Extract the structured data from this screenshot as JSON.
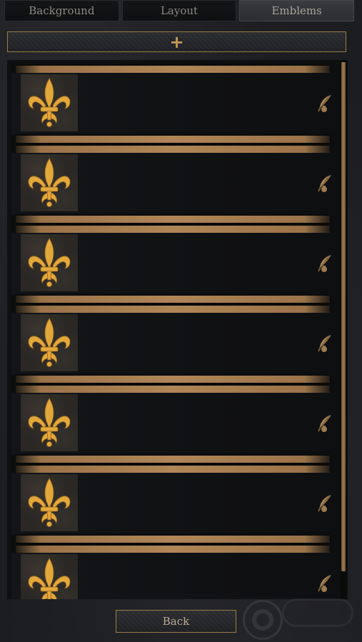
{
  "tabs": [
    {
      "label": "Background",
      "active": false
    },
    {
      "label": "Layout",
      "active": false
    },
    {
      "label": "Emblems",
      "active": true
    }
  ],
  "add_button": {
    "label": "+",
    "icon": "plus-icon"
  },
  "emblem_list": {
    "items": [
      {
        "emblem": "fleur-de-lis",
        "action_icon": "quill-edit-icon"
      },
      {
        "emblem": "fleur-de-lis",
        "action_icon": "quill-edit-icon"
      },
      {
        "emblem": "fleur-de-lis",
        "action_icon": "quill-edit-icon"
      },
      {
        "emblem": "fleur-de-lis",
        "action_icon": "quill-edit-icon"
      },
      {
        "emblem": "fleur-de-lis",
        "action_icon": "quill-edit-icon"
      },
      {
        "emblem": "fleur-de-lis",
        "action_icon": "quill-edit-icon"
      },
      {
        "emblem": "fleur-de-lis",
        "action_icon": "quill-edit-icon"
      }
    ]
  },
  "back_button": {
    "label": "Back"
  },
  "colors": {
    "accent_gold": "#c79a54",
    "emblem_gold": "#e0a63a",
    "bar_bronze": "#b08658",
    "panel_bg": "#0e0f11"
  }
}
